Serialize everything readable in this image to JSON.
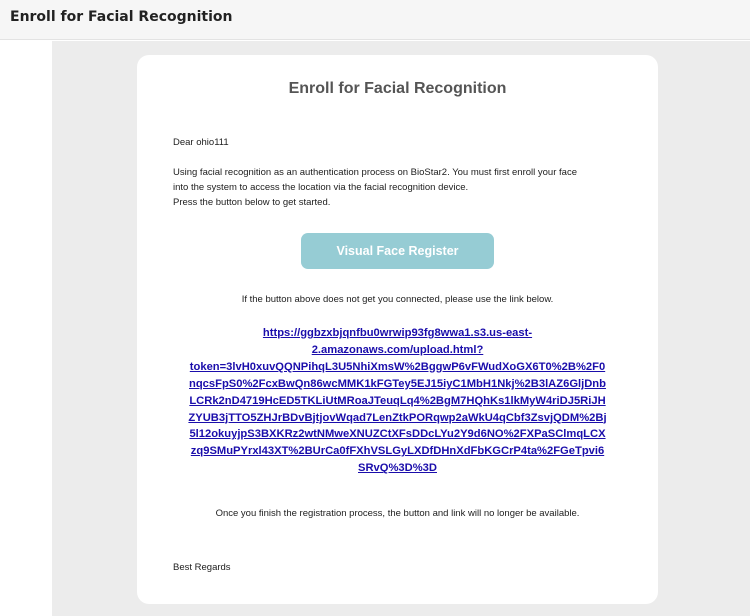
{
  "header": {
    "title": "Enroll for Facial Recognition"
  },
  "email": {
    "heading": "Enroll for Facial Recognition",
    "greeting": "Dear ohio111",
    "body_lines": [
      "Using facial recognition as an authentication process on BioStar2. You must first enroll your face",
      "into the system to access the location via the facial recognition device.",
      "Press the button below to get started."
    ],
    "button_label": "Visual Face Register",
    "button_color": "#96ccd4",
    "fallback_text": "If the button above does not get you connected, please use the link below.",
    "link_lines": [
      "https://ggbzxbjqnfbu0wrwip93fg8wwa1.s3.us-east-",
      "2.amazonaws.com/upload.html?",
      "token=3lvH0xuvQQNPihqL3U5NhiXmsW%2BggwP6vFWudXoGX6T0%2B%2F0",
      "nqcsFpS0%2FcxBwQn86wcMMK1kFGTey5EJ15iyC1MbH1Nkj%2B3lAZ6GljDnb",
      "LCRk2nD4719HcED5TKLiUtMRoaJTeuqLq4%2BgM7HQhKs1lkMyW4riDJ5RiJH",
      "ZYUB3jTTO5ZHJrBDvBjtjovWqad7LenZtkPORqwp2aWkU4qCbf3ZsvjQDM%2Bj",
      "5l12okuyjpS3BXKRz2wtNMweXNUZCtXFsDDcLYu2Y9d6NO%2FXPaSClmqLCX",
      "zq9SMuPYrxl43XT%2BUrCa0fFXhVSLGyLXDfDHnXdFbKGCrP4ta%2FGeTpvi6",
      "SRvQ%3D%3D"
    ],
    "link_color": "#1a0dab",
    "closing_note": "Once you finish the registration process, the button and link will no longer be available.",
    "sign_off": "Best Regards"
  }
}
